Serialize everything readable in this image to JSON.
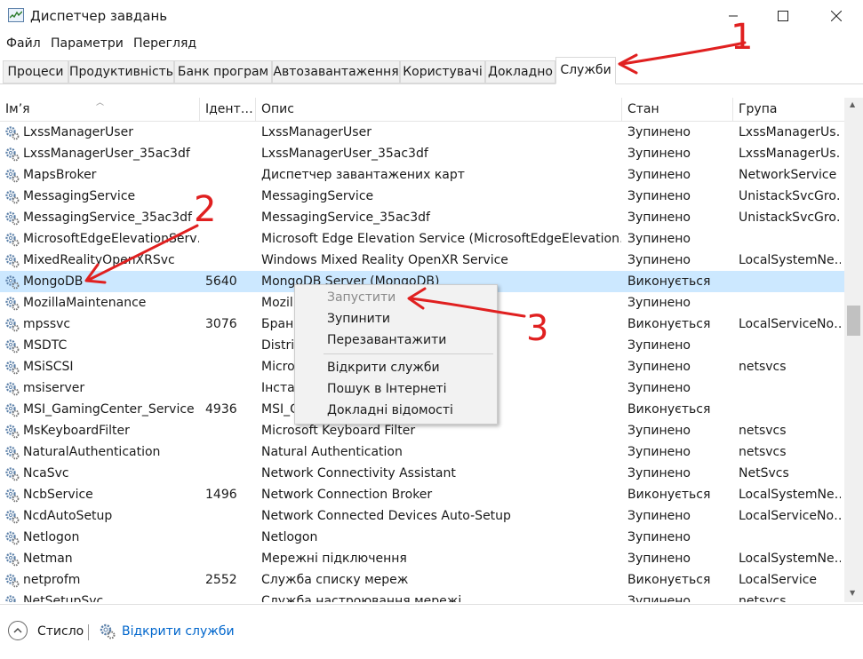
{
  "window": {
    "title": "Диспетчер завдань",
    "controls": {
      "minimize_icon": "minimize-icon",
      "maximize_icon": "maximize-icon",
      "close_icon": "close-icon"
    }
  },
  "menu": {
    "items": [
      "Файл",
      "Параметри",
      "Перегляд"
    ]
  },
  "tabs": [
    {
      "label": "Процеси",
      "active": false
    },
    {
      "label": "Продуктивність",
      "active": false
    },
    {
      "label": "Банк програм",
      "active": false
    },
    {
      "label": "Автозавантаження",
      "active": false
    },
    {
      "label": "Користувачі",
      "active": false
    },
    {
      "label": "Докладно",
      "active": false
    },
    {
      "label": "Служби",
      "active": true
    }
  ],
  "table": {
    "columns": [
      "Ім’я",
      "Ідент…",
      "Опис",
      "Стан",
      "Група"
    ],
    "rows": [
      {
        "name": "LxssManagerUser",
        "pid": "",
        "description": "LxssManagerUser",
        "status": "Зупинено",
        "group": "LxssManagerUs…",
        "selected": false
      },
      {
        "name": "LxssManagerUser_35ac3df",
        "pid": "",
        "description": "LxssManagerUser_35ac3df",
        "status": "Зупинено",
        "group": "LxssManagerUs…",
        "selected": false
      },
      {
        "name": "MapsBroker",
        "pid": "",
        "description": "Диспетчер завантажених карт",
        "status": "Зупинено",
        "group": "NetworkService",
        "selected": false
      },
      {
        "name": "MessagingService",
        "pid": "",
        "description": "MessagingService",
        "status": "Зупинено",
        "group": "UnistackSvcGro…",
        "selected": false
      },
      {
        "name": "MessagingService_35ac3df",
        "pid": "",
        "description": "MessagingService_35ac3df",
        "status": "Зупинено",
        "group": "UnistackSvcGro…",
        "selected": false
      },
      {
        "name": "MicrosoftEdgeElevationServ…",
        "pid": "",
        "description": "Microsoft Edge Elevation Service (MicrosoftEdgeElevation…",
        "status": "Зупинено",
        "group": "",
        "selected": false
      },
      {
        "name": "MixedRealityOpenXRSvc",
        "pid": "",
        "description": "Windows Mixed Reality OpenXR Service",
        "status": "Зупинено",
        "group": "LocalSystemNe…",
        "selected": false
      },
      {
        "name": "MongoDB",
        "pid": "5640",
        "description": "MongoDB Server (MongoDB)",
        "status": "Виконується",
        "group": "",
        "selected": true
      },
      {
        "name": "MozillaMaintenance",
        "pid": "",
        "description": "Mozill",
        "status": "Зупинено",
        "group": "",
        "selected": false
      },
      {
        "name": "mpssvc",
        "pid": "3076",
        "description": "Бранд",
        "status": "Виконується",
        "group": "LocalServiceNo…",
        "selected": false
      },
      {
        "name": "MSDTC",
        "pid": "",
        "description": "Distril",
        "status": "Зупинено",
        "group": "",
        "selected": false
      },
      {
        "name": "MSiSCSI",
        "pid": "",
        "description": "Micro",
        "status": "Зупинено",
        "group": "netsvcs",
        "selected": false
      },
      {
        "name": "msiserver",
        "pid": "",
        "description": "Інстал",
        "status": "Зупинено",
        "group": "",
        "selected": false
      },
      {
        "name": "MSI_GamingCenter_Service",
        "pid": "4936",
        "description": "MSI_G",
        "status": "Виконується",
        "group": "",
        "selected": false
      },
      {
        "name": "MsKeyboardFilter",
        "pid": "",
        "description": "Microsoft Keyboard Filter",
        "status": "Зупинено",
        "group": "netsvcs",
        "selected": false
      },
      {
        "name": "NaturalAuthentication",
        "pid": "",
        "description": "Natural Authentication",
        "status": "Зупинено",
        "group": "netsvcs",
        "selected": false
      },
      {
        "name": "NcaSvc",
        "pid": "",
        "description": "Network Connectivity Assistant",
        "status": "Зупинено",
        "group": "NetSvcs",
        "selected": false
      },
      {
        "name": "NcbService",
        "pid": "1496",
        "description": "Network Connection Broker",
        "status": "Виконується",
        "group": "LocalSystemNe…",
        "selected": false
      },
      {
        "name": "NcdAutoSetup",
        "pid": "",
        "description": "Network Connected Devices Auto-Setup",
        "status": "Зупинено",
        "group": "LocalServiceNo…",
        "selected": false
      },
      {
        "name": "Netlogon",
        "pid": "",
        "description": "Netlogon",
        "status": "Зупинено",
        "group": "",
        "selected": false
      },
      {
        "name": "Netman",
        "pid": "",
        "description": "Мережні підключення",
        "status": "Зупинено",
        "group": "LocalSystemNe…",
        "selected": false
      },
      {
        "name": "netprofm",
        "pid": "2552",
        "description": "Служба списку мереж",
        "status": "Виконується",
        "group": "LocalService",
        "selected": false
      },
      {
        "name": "NetSetupSvc",
        "pid": "",
        "description": "Служба настроювання мережі",
        "status": "Зупинено",
        "group": "netsvcs",
        "selected": false
      }
    ]
  },
  "context_menu": {
    "items": [
      {
        "label": "Запустити",
        "disabled": true
      },
      {
        "label": "Зупинити",
        "disabled": false
      },
      {
        "label": "Перезавантажити",
        "disabled": false
      },
      {
        "label": "Відкрити служби",
        "disabled": false
      },
      {
        "label": "Пошук в Інтернеті",
        "disabled": false
      },
      {
        "label": "Докладні відомості",
        "disabled": false
      }
    ]
  },
  "footer": {
    "fewer_label": "Стисло",
    "open_services_label": "Відкрити служби"
  },
  "annotations": {
    "n1": "1",
    "n2": "2",
    "n3": "3",
    "color": "#e02020"
  },
  "colors": {
    "selected_row": "#cce8ff",
    "link": "#0066cc"
  }
}
